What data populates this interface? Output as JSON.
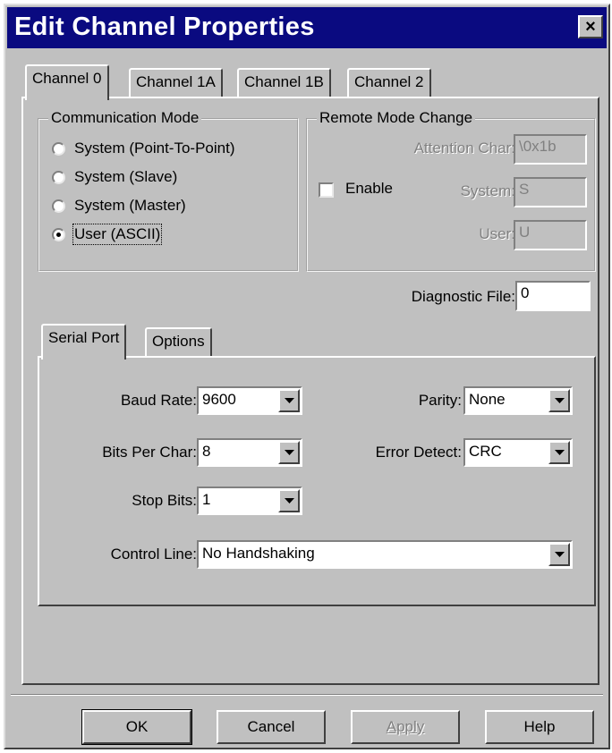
{
  "window": {
    "title": "Edit Channel Properties",
    "close_glyph": "×"
  },
  "channel_tabs": [
    {
      "label": "Channel 0",
      "active": true
    },
    {
      "label": "Channel 1A",
      "active": false
    },
    {
      "label": "Channel 1B",
      "active": false
    },
    {
      "label": "Channel 2",
      "active": false
    }
  ],
  "communication_mode": {
    "legend": "Communication Mode",
    "options": [
      {
        "label": "System (Point-To-Point)",
        "checked": false
      },
      {
        "label": "System (Slave)",
        "checked": false
      },
      {
        "label": "System (Master)",
        "checked": false
      },
      {
        "label": "User (ASCII)",
        "checked": true
      }
    ]
  },
  "remote_mode_change": {
    "legend": "Remote Mode Change",
    "enable_label": "Enable",
    "enable_checked": false,
    "attention_char_label": "Attention Char:",
    "attention_char_value": "\\0x1b",
    "system_label": "System:",
    "system_value": "S",
    "user_label": "User:",
    "user_value": "U"
  },
  "diagnostic_file": {
    "label": "Diagnostic File:",
    "value": "0"
  },
  "sub_tabs": [
    {
      "label": "Serial Port",
      "active": true
    },
    {
      "label": "Options",
      "active": false
    }
  ],
  "serial_port": {
    "baud_rate_label": "Baud Rate:",
    "baud_rate_value": "9600",
    "bits_per_char_label": "Bits Per Char:",
    "bits_per_char_value": "8",
    "stop_bits_label": "Stop Bits:",
    "stop_bits_value": "1",
    "control_line_label": "Control Line:",
    "control_line_value": "No Handshaking",
    "parity_label": "Parity:",
    "parity_value": "None",
    "error_detect_label": "Error Detect:",
    "error_detect_value": "CRC"
  },
  "buttons": {
    "ok": "OK",
    "cancel": "Cancel",
    "apply": "Apply",
    "help": "Help"
  },
  "colors": {
    "title_bar": "#0a0a80",
    "face": "#c0c0c0",
    "disabled_text": "#808080"
  }
}
